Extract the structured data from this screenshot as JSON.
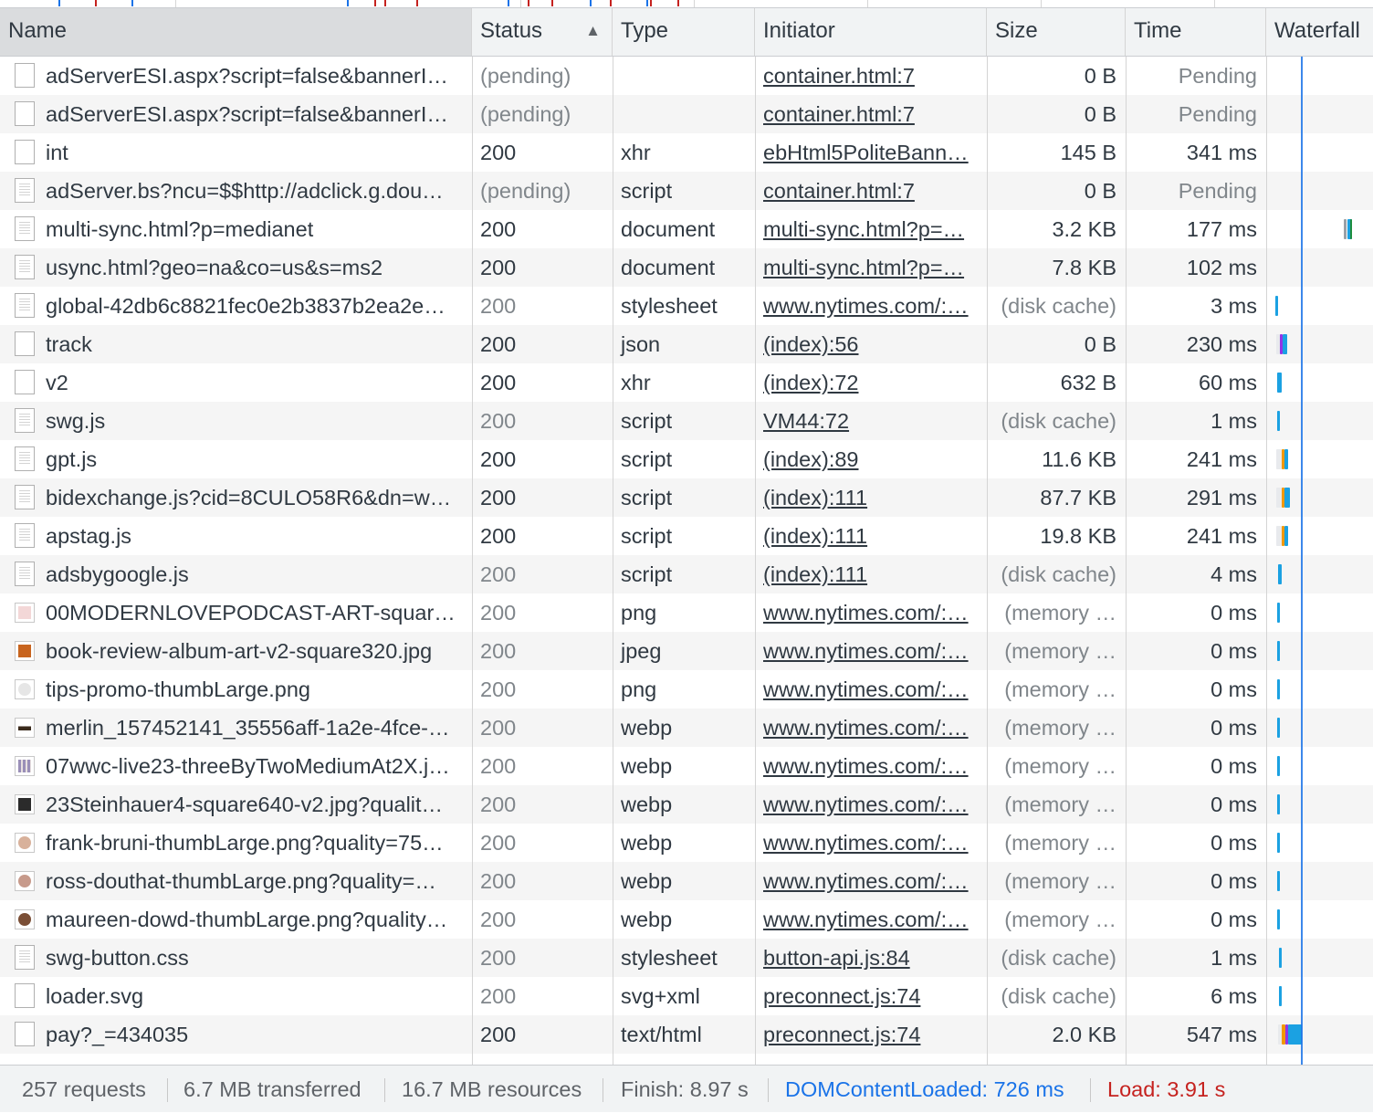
{
  "columns": {
    "name": "Name",
    "status": "Status",
    "type": "Type",
    "initiator": "Initiator",
    "size": "Size",
    "time": "Time",
    "waterfall": "Waterfall"
  },
  "sort_indicator": "▲",
  "rows": [
    {
      "name": "adServerESI.aspx?script=false&bannerI…",
      "status": "(pending)",
      "type": "",
      "initiator": "container.html:7",
      "size": "0 B",
      "time": "Pending",
      "icon": "blank"
    },
    {
      "name": "adServerESI.aspx?script=false&bannerI…",
      "status": "(pending)",
      "type": "",
      "initiator": "container.html:7",
      "size": "0 B",
      "time": "Pending",
      "icon": "blank"
    },
    {
      "name": "int",
      "status": "200",
      "type": "xhr",
      "initiator": "ebHtml5PoliteBann…",
      "size": "145 B",
      "time": "341 ms",
      "icon": "blank"
    },
    {
      "name": "adServer.bs?ncu=$$http://adclick.g.dou…",
      "status": "(pending)",
      "type": "script",
      "initiator": "container.html:7",
      "size": "0 B",
      "time": "Pending",
      "icon": "script"
    },
    {
      "name": "multi-sync.html?p=medianet",
      "status": "200",
      "type": "document",
      "initiator": "multi-sync.html?p=…",
      "size": "3.2 KB",
      "time": "177 ms",
      "icon": "script"
    },
    {
      "name": "usync.html?geo=na&co=us&s=ms2",
      "status": "200",
      "type": "document",
      "initiator": "multi-sync.html?p=…",
      "size": "7.8 KB",
      "time": "102 ms",
      "icon": "script"
    },
    {
      "name": "global-42db6c8821fec0e2b3837b2ea2e…",
      "status": "200",
      "type": "stylesheet",
      "initiator": "www.nytimes.com/:…",
      "size": "(disk cache)",
      "time": "3 ms",
      "icon": "css"
    },
    {
      "name": "track",
      "status": "200",
      "type": "json",
      "initiator": "(index):56",
      "size": "0 B",
      "time": "230 ms",
      "icon": "blank"
    },
    {
      "name": "v2",
      "status": "200",
      "type": "xhr",
      "initiator": "(index):72",
      "size": "632 B",
      "time": "60 ms",
      "icon": "blank"
    },
    {
      "name": "swg.js",
      "status": "200",
      "type": "script",
      "initiator": "VM44:72",
      "size": "(disk cache)",
      "time": "1 ms",
      "icon": "script"
    },
    {
      "name": "gpt.js",
      "status": "200",
      "type": "script",
      "initiator": "(index):89",
      "size": "11.6 KB",
      "time": "241 ms",
      "icon": "script"
    },
    {
      "name": "bidexchange.js?cid=8CULO58R6&dn=w…",
      "status": "200",
      "type": "script",
      "initiator": "(index):111",
      "size": "87.7 KB",
      "time": "291 ms",
      "icon": "script"
    },
    {
      "name": "apstag.js",
      "status": "200",
      "type": "script",
      "initiator": "(index):111",
      "size": "19.8 KB",
      "time": "241 ms",
      "icon": "script"
    },
    {
      "name": "adsbygoogle.js",
      "status": "200",
      "type": "script",
      "initiator": "(index):111",
      "size": "(disk cache)",
      "time": "4 ms",
      "icon": "script"
    },
    {
      "name": "00MODERNLOVEPODCAST-ART-squar…",
      "status": "200",
      "type": "png",
      "initiator": "www.nytimes.com/:…",
      "size": "(memory …",
      "time": "0 ms",
      "icon": "img c1"
    },
    {
      "name": "book-review-album-art-v2-square320.jpg",
      "status": "200",
      "type": "jpeg",
      "initiator": "www.nytimes.com/:…",
      "size": "(memory …",
      "time": "0 ms",
      "icon": "img c2"
    },
    {
      "name": "tips-promo-thumbLarge.png",
      "status": "200",
      "type": "png",
      "initiator": "www.nytimes.com/:…",
      "size": "(memory …",
      "time": "0 ms",
      "icon": "img c3"
    },
    {
      "name": "merlin_157452141_35556aff-1a2e-4fce-…",
      "status": "200",
      "type": "webp",
      "initiator": "www.nytimes.com/:…",
      "size": "(memory …",
      "time": "0 ms",
      "icon": "img c4"
    },
    {
      "name": "07wwc-live23-threeByTwoMediumAt2X.j…",
      "status": "200",
      "type": "webp",
      "initiator": "www.nytimes.com/:…",
      "size": "(memory …",
      "time": "0 ms",
      "icon": "img c5"
    },
    {
      "name": "23Steinhauer4-square640-v2.jpg?qualit…",
      "status": "200",
      "type": "webp",
      "initiator": "www.nytimes.com/:…",
      "size": "(memory …",
      "time": "0 ms",
      "icon": "img c6"
    },
    {
      "name": "frank-bruni-thumbLarge.png?quality=75…",
      "status": "200",
      "type": "webp",
      "initiator": "www.nytimes.com/:…",
      "size": "(memory …",
      "time": "0 ms",
      "icon": "img c7"
    },
    {
      "name": "ross-douthat-thumbLarge.png?quality=…",
      "status": "200",
      "type": "webp",
      "initiator": "www.nytimes.com/:…",
      "size": "(memory …",
      "time": "0 ms",
      "icon": "img c8"
    },
    {
      "name": "maureen-dowd-thumbLarge.png?quality…",
      "status": "200",
      "type": "webp",
      "initiator": "www.nytimes.com/:…",
      "size": "(memory …",
      "time": "0 ms",
      "icon": "img c9"
    },
    {
      "name": "swg-button.css",
      "status": "200",
      "type": "stylesheet",
      "initiator": "button-api.js:84",
      "size": "(disk cache)",
      "time": "1 ms",
      "icon": "css"
    },
    {
      "name": "loader.svg",
      "status": "200",
      "type": "svg+xml",
      "initiator": "preconnect.js:74",
      "size": "(disk cache)",
      "time": "6 ms",
      "icon": "blank"
    },
    {
      "name": "pay?_=434035",
      "status": "200",
      "type": "text/html",
      "initiator": "preconnect.js:74",
      "size": "2.0 KB",
      "time": "547 ms",
      "icon": "blank"
    }
  ],
  "summary": {
    "requests": "257 requests",
    "transferred": "6.7 MB transferred",
    "resources": "16.7 MB resources",
    "finish": "Finish: 8.97 s",
    "dom_content_loaded": "DOMContentLoaded: 726 ms",
    "load": "Load: 3.91 s"
  },
  "colors": {
    "dom_content_loaded": "#1a73e8",
    "load": "#c5221f",
    "waterfall_bar": "#1ba1e2"
  }
}
